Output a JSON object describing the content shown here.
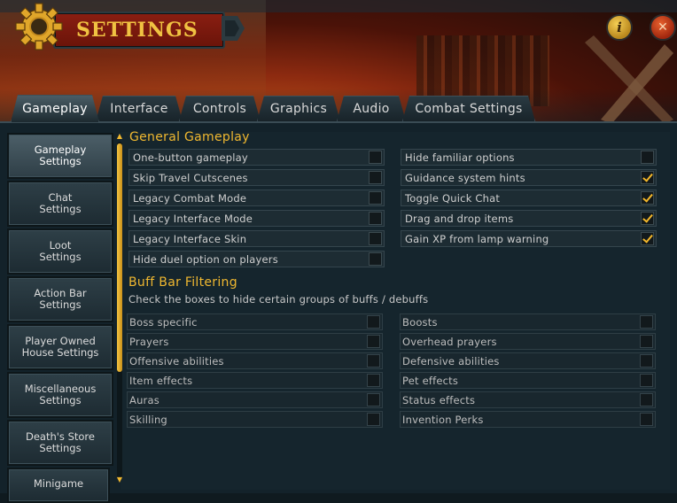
{
  "window": {
    "title": "SETTINGS"
  },
  "tabs": [
    {
      "label": "Gameplay",
      "active": true
    },
    {
      "label": "Interface",
      "active": false
    },
    {
      "label": "Controls",
      "active": false
    },
    {
      "label": "Graphics",
      "active": false
    },
    {
      "label": "Audio",
      "active": false
    },
    {
      "label": "Combat Settings",
      "active": false
    }
  ],
  "sidebar": {
    "items": [
      {
        "label": "Gameplay\nSettings",
        "active": true
      },
      {
        "label": "Chat\nSettings",
        "active": false
      },
      {
        "label": "Loot\nSettings",
        "active": false
      },
      {
        "label": "Action Bar\nSettings",
        "active": false
      },
      {
        "label": "Player Owned\nHouse Settings",
        "active": false
      },
      {
        "label": "Miscellaneous\nSettings",
        "active": false
      },
      {
        "label": "Death's Store\nSettings",
        "active": false
      },
      {
        "label": "Minigame",
        "active": false
      }
    ]
  },
  "general": {
    "title": "General Gameplay",
    "left": [
      {
        "label": "One-button gameplay",
        "checked": false
      },
      {
        "label": "Skip Travel Cutscenes",
        "checked": false
      },
      {
        "label": "Legacy Combat Mode",
        "checked": false
      },
      {
        "label": "Legacy Interface Mode",
        "checked": false
      },
      {
        "label": "Legacy Interface Skin",
        "checked": false
      },
      {
        "label": "Hide duel option on players",
        "checked": false
      }
    ],
    "right": [
      {
        "label": "Hide familiar options",
        "checked": false
      },
      {
        "label": "Guidance system hints",
        "checked": true
      },
      {
        "label": "Toggle Quick Chat",
        "checked": true
      },
      {
        "label": "Drag and drop items",
        "checked": true
      },
      {
        "label": "Gain XP from lamp warning",
        "checked": true
      }
    ]
  },
  "buff": {
    "title": "Buff Bar Filtering",
    "subtitle": "Check the boxes to hide certain groups of buffs / debuffs",
    "left": [
      {
        "label": "Boss specific",
        "checked": false
      },
      {
        "label": "Prayers",
        "checked": false
      },
      {
        "label": "Offensive abilities",
        "checked": false
      },
      {
        "label": "Item effects",
        "checked": false
      },
      {
        "label": "Auras",
        "checked": false
      },
      {
        "label": "Skilling",
        "checked": false
      }
    ],
    "right": [
      {
        "label": "Boosts",
        "checked": false
      },
      {
        "label": "Overhead prayers",
        "checked": false
      },
      {
        "label": "Defensive abilities",
        "checked": false
      },
      {
        "label": "Pet effects",
        "checked": false
      },
      {
        "label": "Status effects",
        "checked": false
      },
      {
        "label": "Invention Perks",
        "checked": false
      }
    ]
  },
  "icons": {
    "settings": "gear-icon",
    "info": "info-icon",
    "close": "close-icon",
    "scroll_up": "scroll-up-arrow-icon",
    "scroll_down": "scroll-down-arrow-icon",
    "check": "checkmark-icon"
  },
  "colors": {
    "accent_gold": "#f0b830",
    "title_red": "#8a1e12",
    "panel_bg": "#13222a"
  }
}
